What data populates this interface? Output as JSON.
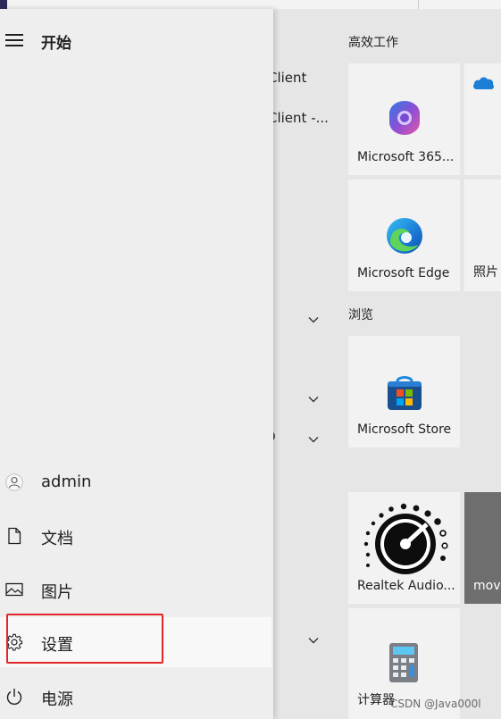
{
  "start_menu": {
    "title": "开始",
    "nav": [
      {
        "label": "admin",
        "icon": "user-avatar-icon"
      },
      {
        "label": "文档",
        "icon": "document-icon"
      },
      {
        "label": "图片",
        "icon": "picture-icon"
      },
      {
        "label": "设置",
        "icon": "gear-icon"
      },
      {
        "label": "电源",
        "icon": "power-icon"
      }
    ]
  },
  "app_list": {
    "items": [
      "Client",
      "Client -..."
    ],
    "stray_glyph": "9"
  },
  "tiles": {
    "groups": [
      {
        "title": "高效工作"
      },
      {
        "title": "浏览"
      }
    ],
    "apps": [
      {
        "label": "Microsoft 365...",
        "icon": "microsoft-365-icon"
      },
      {
        "label": "",
        "icon": "onedrive-icon"
      },
      {
        "label": "Microsoft Edge",
        "icon": "edge-icon"
      },
      {
        "label": "照片",
        "icon": "photos-icon"
      },
      {
        "label": "Microsoft Store",
        "icon": "store-icon"
      },
      {
        "label": "Realtek Audio...",
        "icon": "realtek-audio-icon"
      },
      {
        "label": "move",
        "icon": "movies-icon"
      },
      {
        "label": "计算器",
        "icon": "calculator-icon"
      }
    ]
  },
  "watermark": "CSDN @Java000l",
  "colors": {
    "highlight": "#e0262b",
    "panel_bg": "#eeeeee",
    "tile_bg": "#f2f2f2"
  }
}
